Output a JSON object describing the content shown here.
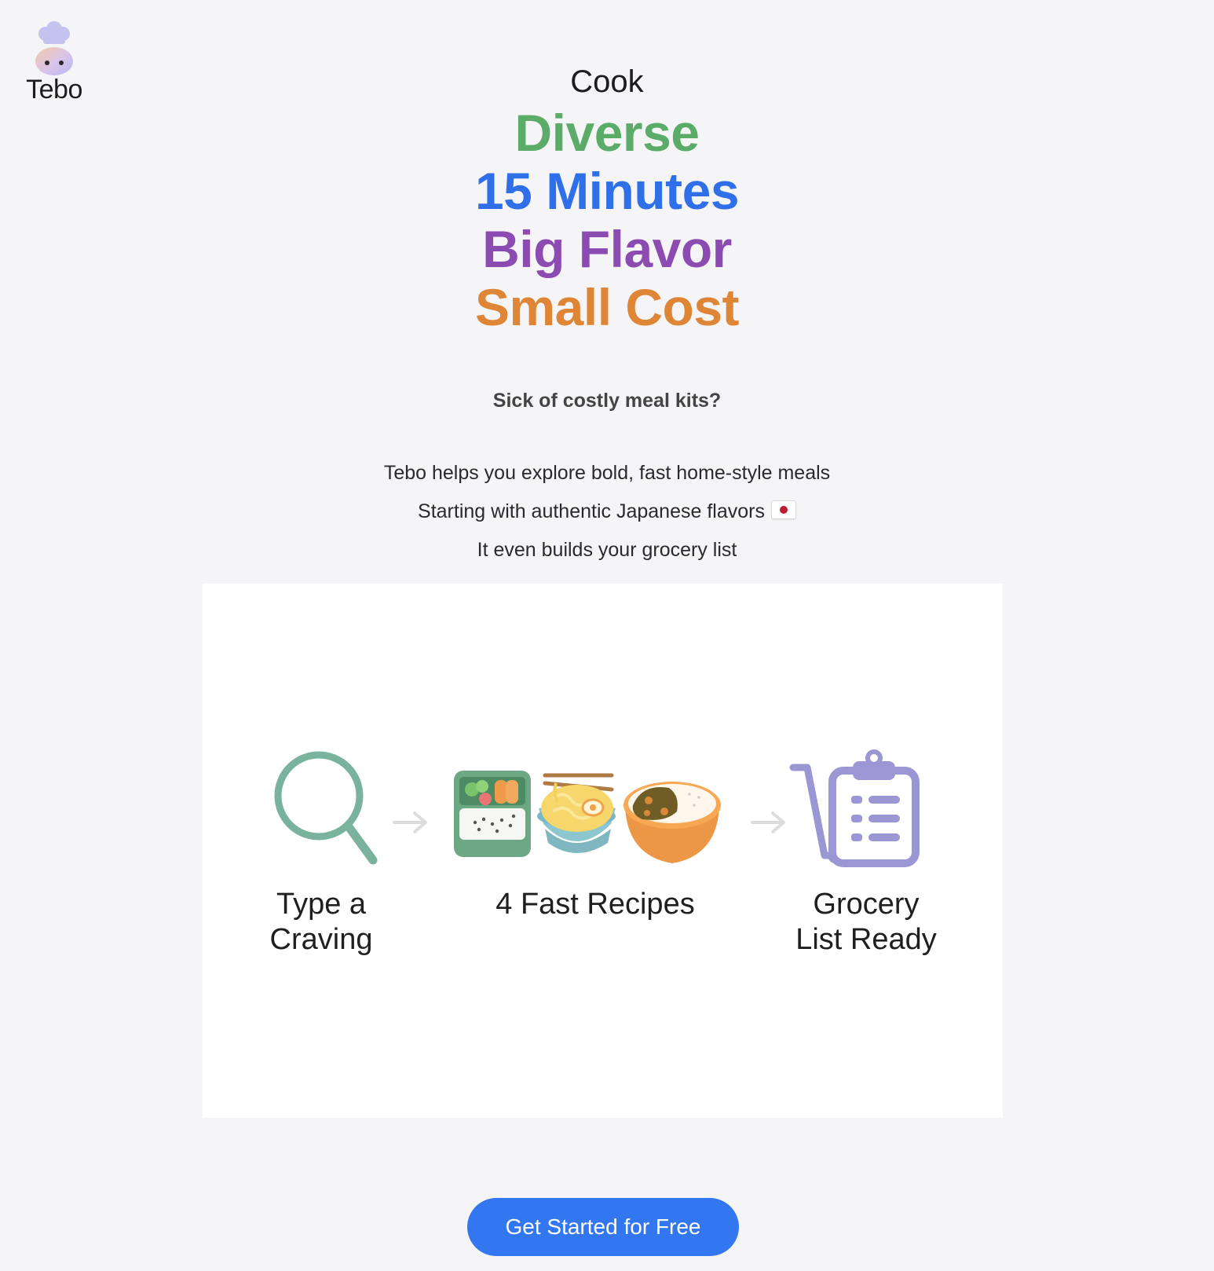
{
  "brand": {
    "name": "Tebo",
    "logo_icon": "chef-robot-icon"
  },
  "hero": {
    "intro": "Cook",
    "lines": [
      {
        "text": "Diverse",
        "color": "#5bab69"
      },
      {
        "text": "15 Minutes",
        "color": "#2f6fe8"
      },
      {
        "text": "Big Flavor",
        "color": "#8c4bb1"
      },
      {
        "text": "Small Cost",
        "color": "#de8536"
      }
    ]
  },
  "tagline": "Sick of costly meal kits?",
  "description": {
    "line1": "Tebo helps you explore bold, fast home-style meals",
    "line2": "Starting with authentic Japanese flavors",
    "line2_icon": "japan-flag-icon",
    "line3": "It even builds your grocery list"
  },
  "steps": [
    {
      "icon": "magnifier-icon",
      "label_line1": "Type a",
      "label_line2": "Craving"
    },
    {
      "icon": "recipe-bowls-icon",
      "label_line1": "4 Fast Recipes",
      "label_line2": ""
    },
    {
      "icon": "grocery-cart-clipboard-icon",
      "label_line1": "Grocery",
      "label_line2": "List Ready"
    }
  ],
  "cta": {
    "label": "Get Started for Free",
    "color": "#3377f0"
  }
}
